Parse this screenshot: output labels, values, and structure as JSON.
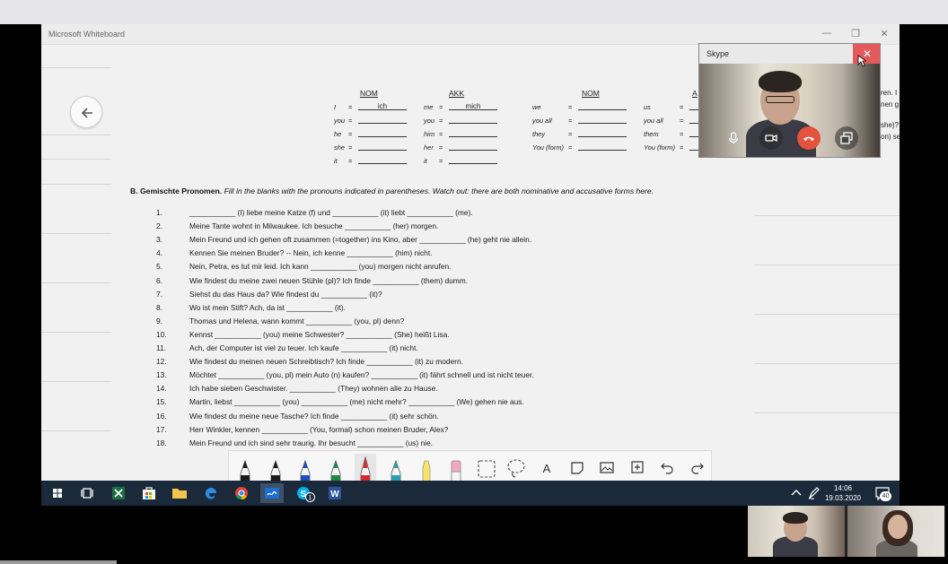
{
  "whiteboard": {
    "title": "Microsoft Whiteboard",
    "controls": {
      "minimize": "—",
      "restore": "❐",
      "close": "✕"
    },
    "tables": [
      {
        "nom_header": "NOM",
        "akk_header": "AKK",
        "rows": [
          {
            "nom_label": "I",
            "nom_value": "ich",
            "akk_label": "me",
            "akk_value": "mich"
          },
          {
            "nom_label": "you",
            "nom_value": "",
            "akk_label": "you",
            "akk_value": ""
          },
          {
            "nom_label": "he",
            "nom_value": "",
            "akk_label": "him",
            "akk_value": ""
          },
          {
            "nom_label": "she",
            "nom_value": "",
            "akk_label": "her",
            "akk_value": ""
          },
          {
            "nom_label": "it",
            "nom_value": "",
            "akk_label": "it",
            "akk_value": ""
          }
        ]
      },
      {
        "nom_header": "NOM",
        "akk_header": "A",
        "rows": [
          {
            "nom_label": "we",
            "nom_value": "",
            "akk_label": "us",
            "akk_value": ""
          },
          {
            "nom_label": "you all",
            "nom_value": "",
            "akk_label": "you all",
            "akk_value": ""
          },
          {
            "nom_label": "they",
            "nom_value": "",
            "akk_label": "them",
            "akk_value": ""
          },
          {
            "nom_label": "You (form)",
            "nom_value": "",
            "akk_label": "You (form)",
            "akk_value": ""
          }
        ]
      }
    ],
    "instructions": {
      "heading": "B. Gemischte Pronomen.",
      "text": "Fill in the blanks with the pronouns indicated in parentheses. Watch out: there are both nominative and accusative forms here."
    },
    "exercises": [
      {
        "num": "1.",
        "text": "___________ (I) liebe meine Katze (f) und ___________ (it) liebt ___________ (me)."
      },
      {
        "num": "2.",
        "text": "Meine Tante wohnt in Milwaukee. Ich besuche ___________ (her) morgen."
      },
      {
        "num": "3.",
        "text": "Mein Freund und ich gehen oft zusammen (=together) ins Kino, aber ___________ (he) geht nie allein."
      },
      {
        "num": "4.",
        "text": "Kennen Sie meinen Bruder? -- Nein, ich kenne ___________ (him) nicht."
      },
      {
        "num": "5.",
        "text": "Nein, Petra, es tut mir leid. Ich kann ___________ (you) morgen nicht anrufen."
      },
      {
        "num": "6.",
        "text": "Wie findest du meine zwei neuen Stühle (pl)? Ich finde ___________ (them) dumm."
      },
      {
        "num": "7.",
        "text": "Siehst du das Haus da? Wie findest du ___________ (it)?"
      },
      {
        "num": "8.",
        "text": "Wo ist mein Stift? Ach, da ist ___________ (it)."
      },
      {
        "num": "9.",
        "text": "Thomas und Helena, wann kommt ___________ (you, pl) denn?"
      },
      {
        "num": "10.",
        "text": "Kennst ___________ (you) meine Schwester? ___________ (She) heißt Lisa."
      },
      {
        "num": "11.",
        "text": "Ach, der Computer ist viel zu teuer. Ich kaufe ___________ (it) nicht."
      },
      {
        "num": "12.",
        "text": "Wie findest du meinen neuen Schreibtisch? Ich finde ___________ (it) zu modern."
      },
      {
        "num": "13.",
        "text": "Möchtet ___________ (you, pl) mein Auto (n) kaufen? ___________ (it) fährt schnell und ist nicht teuer."
      },
      {
        "num": "14.",
        "text": "Ich habe sieben Geschwister. ___________ (They) wohnen alle zu Hause."
      },
      {
        "num": "15.",
        "text": "Martin, liebst ___________ (you) ___________ (me) nicht mehr? ___________ (We) gehen nie aus."
      },
      {
        "num": "16.",
        "text": "Wie findest du meine neue Tasche? Ich finde ___________ (it) sehr schön."
      },
      {
        "num": "17.",
        "text": "Herr Winkler, kennen ___________ (You, formal) schon meinen Bruder, Alex?"
      },
      {
        "num": "18.",
        "text": "Mein Freund und ich sind sehr traurig. Ihr besucht ___________ (us) nie."
      }
    ],
    "overflow_text": [
      "ren. I",
      "nen g",
      "she)? l",
      "on) sel"
    ]
  },
  "skype": {
    "title": "Skype",
    "close": "✕"
  },
  "ink_toolbar": {
    "tools": [
      "pen-black-icon",
      "pen-black-icon",
      "pen-blue-icon",
      "pen-green-icon",
      "pen-red-icon",
      "pen-teal-icon",
      "highlighter-icon",
      "eraser-icon",
      "ruler-icon",
      "lasso-icon",
      "text-icon",
      "note-icon",
      "image-icon",
      "insert-icon",
      "undo-icon",
      "redo-icon"
    ],
    "text_tool_label": "A"
  },
  "taskbar": {
    "time": "14:06",
    "date": "19.03.2020",
    "skype_badge": "1",
    "notification_count": "40"
  },
  "colors": {
    "accent_red": "#e3533e",
    "taskbar": "#1b2a3a",
    "skype_close": "#e35a5a"
  }
}
